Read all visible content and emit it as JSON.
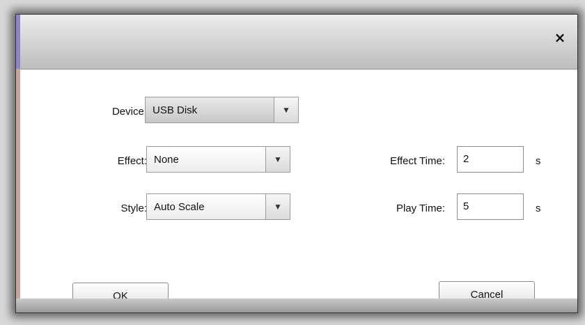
{
  "dialog": {
    "close_symbol": "×",
    "device": {
      "label": "Device:",
      "value": "USB Disk",
      "arrow": "▼"
    },
    "effect": {
      "label": "Effect:",
      "value": "None",
      "arrow": "▼"
    },
    "style": {
      "label": "Style:",
      "value": "Auto Scale",
      "arrow": "▼"
    },
    "effect_time": {
      "label": "Effect Time:",
      "value": "2",
      "unit": "s"
    },
    "play_time": {
      "label": "Play Time:",
      "value": "5",
      "unit": "s"
    },
    "ok_label": "OK",
    "cancel_label": "Cancel"
  }
}
